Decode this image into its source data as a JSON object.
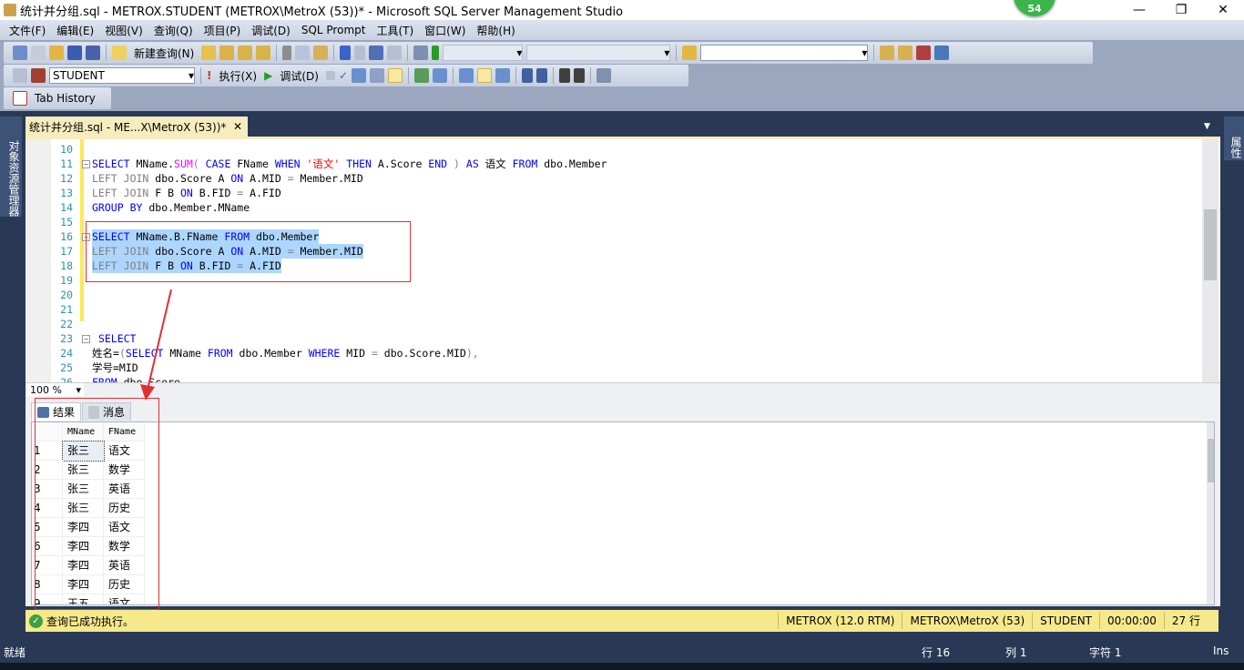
{
  "window": {
    "title": "统计并分组.sql - METROX.STUDENT (METROX\\MetroX (53))* - Microsoft SQL Server Management Studio",
    "badge": "54"
  },
  "menu": [
    "文件(F)",
    "编辑(E)",
    "视图(V)",
    "查询(Q)",
    "项目(P)",
    "调试(D)",
    "SQL Prompt",
    "工具(T)",
    "窗口(W)",
    "帮助(H)"
  ],
  "toolbar": {
    "new_query": "新建查询(N)",
    "database": "STUDENT",
    "execute": "执行(X)",
    "debug": "调试(D)",
    "tab_history": "Tab History"
  },
  "sidebars": {
    "left": "对象资源管理器",
    "right": "属性"
  },
  "doc_tab": {
    "label": "统计并分组.sql - ME...X\\MetroX (53))*",
    "close": "✕"
  },
  "editor": {
    "zoom": "100 %",
    "lines": [
      {
        "n": "10",
        "code": ""
      },
      {
        "n": "11",
        "code": "SELECT MName.SUM( CASE FName WHEN '语文' THEN A.Score END ) AS 语文 FROM dbo.Member"
      },
      {
        "n": "12",
        "code": "LEFT JOIN dbo.Score A ON A.MID = Member.MID"
      },
      {
        "n": "13",
        "code": "LEFT JOIN F B ON B.FID = A.FID"
      },
      {
        "n": "14",
        "code": "GROUP BY dbo.Member.MName"
      },
      {
        "n": "15",
        "code": ""
      },
      {
        "n": "16",
        "code": "SELECT MName.B.FName FROM dbo.Member"
      },
      {
        "n": "17",
        "code": "LEFT JOIN dbo.Score A ON A.MID = Member.MID"
      },
      {
        "n": "18",
        "code": "LEFT JOIN F B ON B.FID = A.FID"
      },
      {
        "n": "19",
        "code": ""
      },
      {
        "n": "20",
        "code": ""
      },
      {
        "n": "21",
        "code": ""
      },
      {
        "n": "22",
        "code": ""
      },
      {
        "n": "23",
        "code": " SELECT"
      },
      {
        "n": "24",
        "code": "姓名=(SELECT MName FROM dbo.Member WHERE MID = dbo.Score.MID),"
      },
      {
        "n": "25",
        "code": "学号=MID"
      },
      {
        "n": "26",
        "code": "FROM dbo.Score"
      }
    ]
  },
  "results": {
    "tabs": [
      "结果",
      "消息"
    ],
    "columns": [
      "MName",
      "FName"
    ],
    "rows": [
      [
        "1",
        "张三",
        "语文"
      ],
      [
        "2",
        "张三",
        "数学"
      ],
      [
        "3",
        "张三",
        "英语"
      ],
      [
        "4",
        "张三",
        "历史"
      ],
      [
        "5",
        "李四",
        "语文"
      ],
      [
        "6",
        "李四",
        "数学"
      ],
      [
        "7",
        "李四",
        "英语"
      ],
      [
        "8",
        "李四",
        "历史"
      ],
      [
        "9",
        "王五",
        "语文"
      ]
    ]
  },
  "query_status": {
    "message": "查询已成功执行。",
    "server": "METROX (12.0 RTM)",
    "login": "METROX\\MetroX (53)",
    "database": "STUDENT",
    "elapsed": "00:00:00",
    "rows": "27 行"
  },
  "status_bar": {
    "ready": "就绪",
    "line": "行 16",
    "col": "列 1",
    "char": "字符 1",
    "mode": "Ins"
  },
  "colors": {
    "annotation": "#e03030",
    "query_status_bg": "#f6e98c",
    "chrome": "#293955"
  }
}
